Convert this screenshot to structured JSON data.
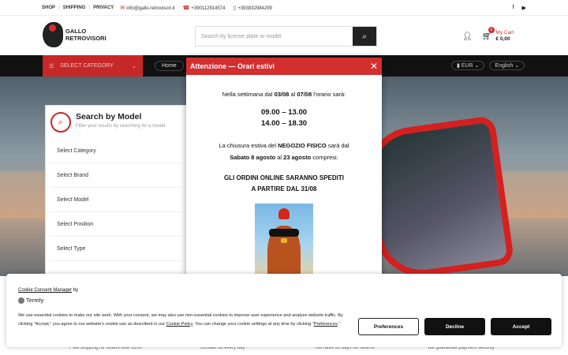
{
  "topbar": {
    "nav": [
      "SHOP",
      "SHIPPING",
      "PRIVACY"
    ],
    "email": "info@gallo-retrovisori.it",
    "phone1": "+390112914574",
    "phone2": "+393832984299",
    "social": [
      "facebook-icon",
      "youtube-icon"
    ]
  },
  "header": {
    "logo_line1": "GALLO",
    "logo_line2": "RETROVISORI",
    "search_placeholder": "Search by license plate or model",
    "cart_badge": "0",
    "cart_label": "My Cart",
    "cart_total": "€ 0,00"
  },
  "navbar": {
    "category": "SELECT CATEGORY",
    "home": "Home",
    "currency": "EUR",
    "language": "English"
  },
  "search_model": {
    "title": "Search by Model",
    "subtitle": "Filter your results by searching for a model",
    "selects": [
      "Select Category",
      "Select Brand",
      "Select Model",
      "Select Position",
      "Select Type"
    ]
  },
  "modal": {
    "title": "Attenzione — Orari estivi",
    "week_prefix": "Nella settimana dal ",
    "date_from": "03/08",
    "week_mid": " al ",
    "date_to": "07/08",
    "week_suffix": " l'orario sarà:",
    "hours1": "09.00 – 13.00",
    "hours2": "14.00 – 18.30",
    "closing_prefix": "La chiusura estiva del ",
    "store": "NEGOZIO FISICO",
    "closing_suffix": " sarà dal",
    "closing_from": "Sabato 8 agosto",
    "closing_mid": " al ",
    "closing_to": "23 agosto",
    "closing_end": " compresi.",
    "orders_line1": "GLI ORDINI ONLINE SARANNO SPEDITI",
    "orders_line2": "A PARTIRE DAL 31/08"
  },
  "features": [
    "Free shipping for orders over €100",
    "Contact us every day",
    "You have 30 days for returns",
    "We guarantee payment security"
  ],
  "cookie": {
    "title_link": "Cookie Consent Manager",
    "title_suffix": " by",
    "brand": "Termly",
    "text1": "We use essential cookies to make our site work. With your consent, we may also use non-essential cookies to improve user experience and analyze website traffic. By clicking “Accept,” you agree to our website's cookie use as described in our ",
    "policy_link": "Cookie Policy",
    "text2": ". You can change your cookie settings at any time by clicking “",
    "prefs_link": "Preferences",
    "text3": ".”",
    "btn_preferences": "Preferences",
    "btn_decline": "Decline",
    "btn_accept": "Accept"
  },
  "colors": {
    "accent": "#d32f2f",
    "dark": "#111111"
  }
}
